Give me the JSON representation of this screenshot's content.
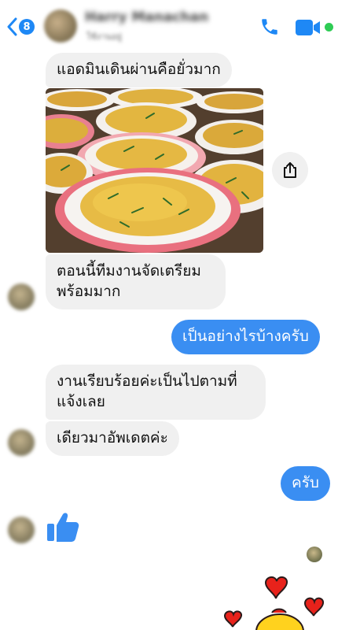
{
  "header": {
    "unread_count": "8",
    "contact_name": "Harry Manachan",
    "status": "ใช้งานอยู่",
    "icons": [
      "back-chevron-icon",
      "phone-icon",
      "video-camera-icon"
    ],
    "accent_color": "#1e88f5",
    "online_color": "#2fcc55"
  },
  "messages": [
    {
      "side": "in",
      "text": "แอดมินเดินผ่านคือยั่วมาก"
    },
    {
      "side": "in",
      "type": "photo",
      "description": "noodles"
    },
    {
      "side": "in",
      "line1": "ตอนนี้ทีมงานจัดเตรียม",
      "line2": "พร้อมมาก"
    },
    {
      "side": "out",
      "text": "เป็นอย่างไรบ้างครับ"
    },
    {
      "side": "in",
      "line1": "งานเรียบร้อยค่ะเป็นไปตามที่",
      "line2": "แจ้งเลย"
    },
    {
      "side": "in",
      "text": "เดียวมาอัพเดตค่ะ"
    },
    {
      "side": "out",
      "text": "ครับ"
    },
    {
      "side": "in",
      "type": "like",
      "icon": "thumbs-up-icon"
    }
  ],
  "colors": {
    "outgoing_bubble": "#3a8ef2",
    "incoming_bubble": "#f0f0f0",
    "heart": "#e8221b"
  }
}
